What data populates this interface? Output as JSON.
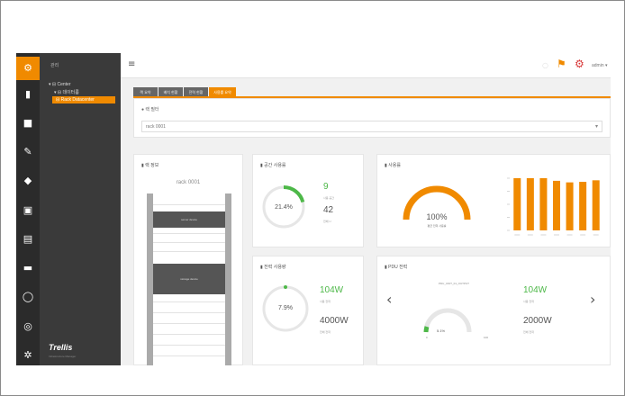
{
  "rail": {
    "icons": [
      "gear-icon",
      "server-icon",
      "folder-icon",
      "wrench-icon",
      "shield-icon",
      "box-icon",
      "file-icon",
      "folder-icon",
      "power-icon",
      "globe-icon",
      "settings-icon"
    ]
  },
  "tree": {
    "header": "관리",
    "node1": "▾ ⊟ Center",
    "node2": "▾ ⊟ 데이터룸",
    "node3": "⊟ Rack Datacenter",
    "logo": "Trellis",
    "logo_sub": "Infrastructure Manager"
  },
  "topbar": {
    "user": "admin ▾"
  },
  "tabs": [
    "랙 요약",
    "배치 현황",
    "전력 현황",
    "사용률 요약"
  ],
  "filter": {
    "label": "● 랙 필터",
    "value": "rack 0001"
  },
  "rack_card": {
    "title": "▮ 랙 정보",
    "rack_name": "rack 0001",
    "device1": "server device",
    "device2": "storage device"
  },
  "space_card": {
    "title": "▮ 공간 사용률",
    "percent": "21.4%",
    "used": "9",
    "used_label": "사용 공간",
    "total": "42",
    "total_label": "전체 U"
  },
  "util_card": {
    "title": "▮ 사용률",
    "percent": "100%",
    "label": "평균 전력 사용률"
  },
  "power_card": {
    "title": "▮ 전력 사용량",
    "percent": "7.9%",
    "used": "104W",
    "used_label": "사용 전력",
    "total": "4000W",
    "total_label": "전체 전력"
  },
  "pdu_card": {
    "title": "▮ PDU 전력",
    "pdu_name": "PDU_UNIT_01_OUTPUT",
    "percent": "5.1%",
    "used": "104W",
    "used_label": "사용 전력",
    "total": "2000W",
    "total_label": "전체 전력",
    "range_min": "0",
    "range_max": "100"
  },
  "chart_data": {
    "type": "bar",
    "categories": [
      "1",
      "2",
      "3",
      "4",
      "5",
      "6",
      "7"
    ],
    "values": [
      100,
      100,
      100,
      95,
      92,
      93,
      96
    ],
    "ylim": [
      0,
      100
    ],
    "color": "#f08a00"
  },
  "colors": {
    "accent": "#f08a00",
    "green": "#4db848",
    "rail": "#2b2b2b",
    "tree": "#3a3a3a"
  }
}
